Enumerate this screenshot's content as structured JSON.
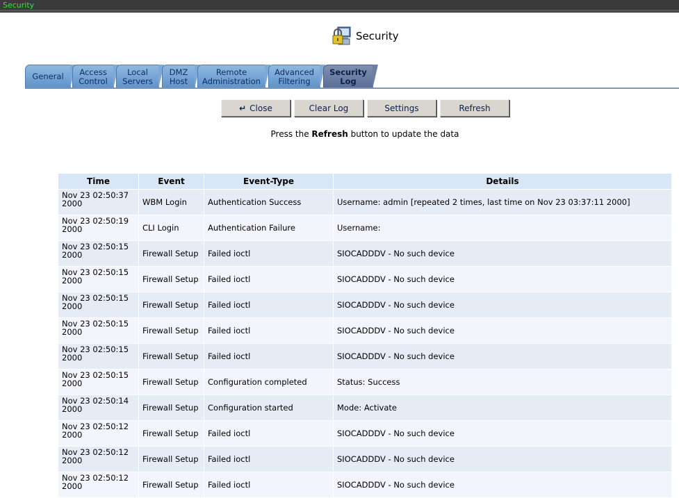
{
  "window": {
    "title": "Security"
  },
  "page": {
    "heading": "Security",
    "icon": "padlock-computer-icon"
  },
  "tabs": [
    {
      "label": "General"
    },
    {
      "label": "Access Control"
    },
    {
      "label": "Local Servers"
    },
    {
      "label": "DMZ Host"
    },
    {
      "label": "Remote Administration"
    },
    {
      "label": "Advanced Filtering"
    },
    {
      "label": "Security Log",
      "active": true
    }
  ],
  "buttons": {
    "close": "Close",
    "clear_log": "Clear Log",
    "settings": "Settings",
    "refresh": "Refresh"
  },
  "note": {
    "prefix": "Press the ",
    "bold": "Refresh",
    "suffix": " button to update the data"
  },
  "table": {
    "headers": [
      "Time",
      "Event",
      "Event-Type",
      "Details"
    ],
    "rows": [
      {
        "time": "Nov 23 02:50:37 2000",
        "event": "WBM Login",
        "type": "Authentication Success",
        "details": "Username: admin [repeated 2 times, last time on Nov 23 03:37:11 2000]"
      },
      {
        "time": "Nov 23 02:50:19 2000",
        "event": "CLI Login",
        "type": "Authentication Failure",
        "details": "Username:"
      },
      {
        "time": "Nov 23 02:50:15 2000",
        "event": "Firewall Setup",
        "type": "Failed ioctl",
        "details": "SIOCADDDV - No such device"
      },
      {
        "time": "Nov 23 02:50:15 2000",
        "event": "Firewall Setup",
        "type": "Failed ioctl",
        "details": "SIOCADDDV - No such device"
      },
      {
        "time": "Nov 23 02:50:15 2000",
        "event": "Firewall Setup",
        "type": "Failed ioctl",
        "details": "SIOCADDDV - No such device"
      },
      {
        "time": "Nov 23 02:50:15 2000",
        "event": "Firewall Setup",
        "type": "Failed ioctl",
        "details": "SIOCADDDV - No such device"
      },
      {
        "time": "Nov 23 02:50:15 2000",
        "event": "Firewall Setup",
        "type": "Failed ioctl",
        "details": "SIOCADDDV - No such device"
      },
      {
        "time": "Nov 23 02:50:15 2000",
        "event": "Firewall Setup",
        "type": "Configuration completed",
        "details": "Status: Success"
      },
      {
        "time": "Nov 23 02:50:14 2000",
        "event": "Firewall Setup",
        "type": "Configuration started",
        "details": "Mode: Activate"
      },
      {
        "time": "Nov 23 02:50:12 2000",
        "event": "Firewall Setup",
        "type": "Failed ioctl",
        "details": "SIOCADDDV - No such device"
      },
      {
        "time": "Nov 23 02:50:12 2000",
        "event": "Firewall Setup",
        "type": "Failed ioctl",
        "details": "SIOCADDDV - No such device"
      },
      {
        "time": "Nov 23 02:50:12 2000",
        "event": "Firewall Setup",
        "type": "Failed ioctl",
        "details": "SIOCADDDV - No such device"
      }
    ]
  }
}
